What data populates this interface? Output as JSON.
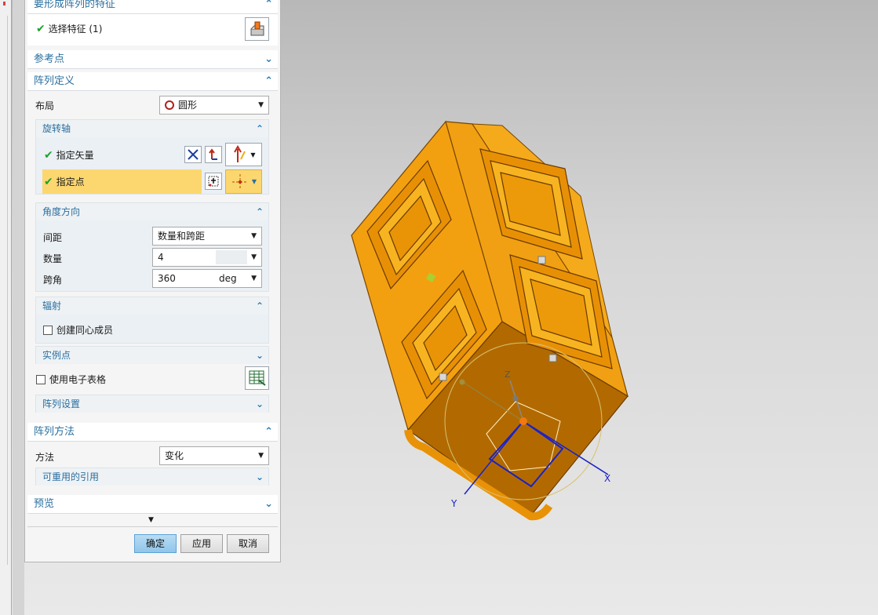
{
  "sections": {
    "feature": {
      "title": "要形成阵列的特征",
      "select_label": "选择特征 (1)"
    },
    "ref_point": {
      "title": "参考点"
    },
    "array_def": {
      "title": "阵列定义",
      "layout_label": "布局",
      "layout_value": "圆形",
      "rotation_axis": {
        "title": "旋转轴",
        "vector_label": "指定矢量",
        "point_label": "指定点"
      },
      "angle_direction": {
        "title": "角度方向",
        "spacing_label": "间距",
        "spacing_value": "数量和跨距",
        "count_label": "数量",
        "count_value": "4",
        "span_label": "跨角",
        "span_value": "360",
        "span_unit": "deg"
      },
      "radiation": {
        "title": "辐射",
        "concentric_label": "创建同心成员"
      },
      "instance_points": {
        "title": "实例点"
      },
      "spreadsheet_label": "使用电子表格",
      "array_settings": {
        "title": "阵列设置"
      }
    },
    "array_method": {
      "title": "阵列方法",
      "method_label": "方法",
      "method_value": "变化",
      "reusable_refs": "可重用的引用"
    },
    "preview": {
      "title": "预览"
    }
  },
  "buttons": {
    "ok": "确定",
    "apply": "应用",
    "cancel": "取消"
  },
  "axes": {
    "x": "X",
    "y": "Y",
    "z": "Z"
  },
  "colors": {
    "accent": "#2b6f9e",
    "model": "#f0a010",
    "highlight_row": "#fcd76f",
    "ok_button": "#9fcdef"
  }
}
